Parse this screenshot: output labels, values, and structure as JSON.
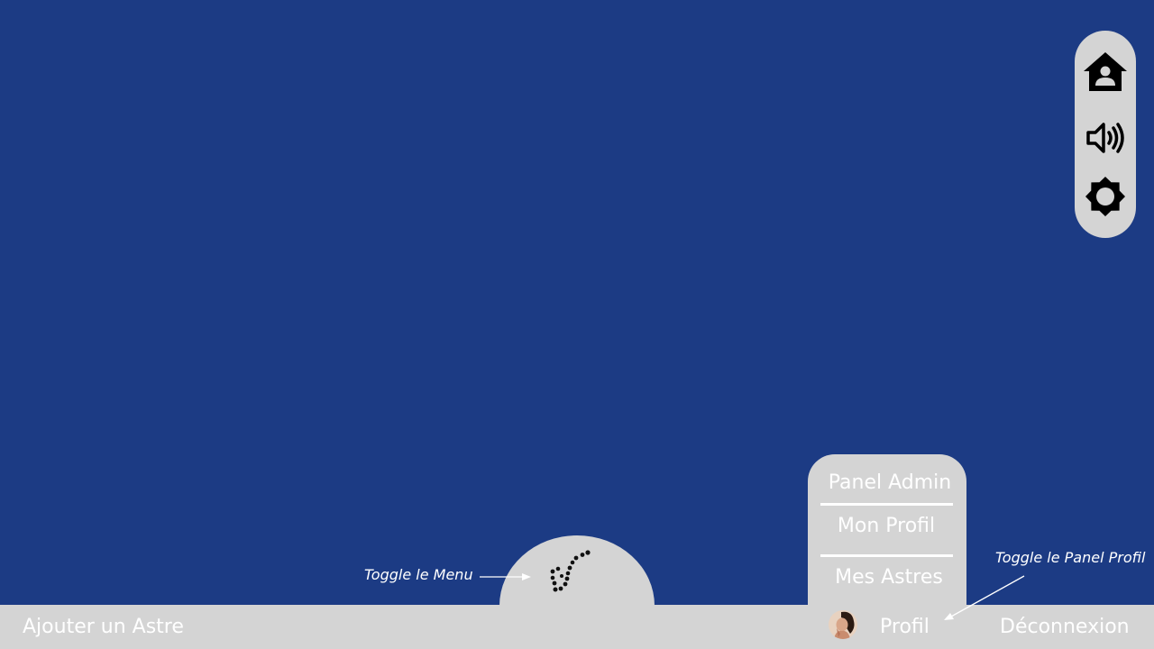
{
  "colors": {
    "background": "#1c3b84",
    "panel": "#d4d4d4",
    "text": "#ffffff",
    "icon": "#000000"
  },
  "toolbar": {
    "icons": [
      "home-user-icon",
      "volume-icon",
      "brightness-icon"
    ]
  },
  "bottom_bar": {
    "add_label": "Ajouter un Astre",
    "profile_label": "Profil",
    "logout_label": "Déconnexion"
  },
  "menu_toggle": {
    "icon": "constellation-icon"
  },
  "profile_panel": {
    "items": [
      {
        "label": "Panel Admin"
      },
      {
        "label": "Mon Profil"
      },
      {
        "label": "Mes Astres"
      }
    ]
  },
  "annotations": {
    "menu_hint": "Toggle le Menu",
    "profile_hint": "Toggle le Panel Profil"
  }
}
